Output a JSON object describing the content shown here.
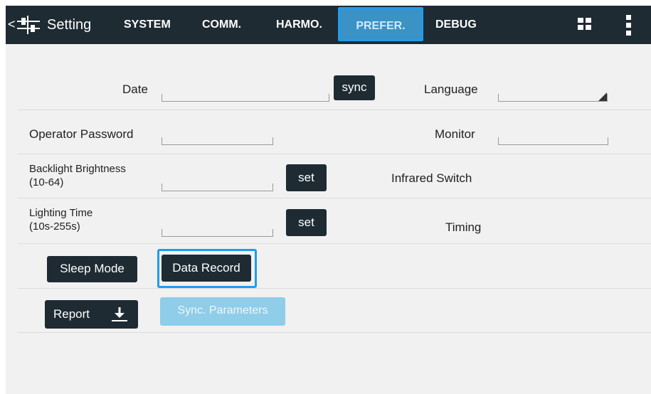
{
  "header": {
    "back_glyph": "<",
    "title": "Setting",
    "tabs": [
      {
        "label": "SYSTEM",
        "active": false
      },
      {
        "label": "COMM.",
        "active": false
      },
      {
        "label": "HARMO.",
        "active": false
      },
      {
        "label": "PREFER.",
        "active": true
      },
      {
        "label": "DEBUG",
        "active": false
      }
    ],
    "icons": [
      "settings-sliders-icon",
      "grid-icon",
      "more-vert-icon"
    ]
  },
  "form": {
    "date": {
      "label": "Date",
      "value": "",
      "sync_label": "sync"
    },
    "language": {
      "label": "Language",
      "value": ""
    },
    "operator_password": {
      "label": "Operator Password",
      "value": ""
    },
    "monitor": {
      "label": "Monitor",
      "value": ""
    },
    "backlight": {
      "label_line1": "Backlight Brightness",
      "label_line2": "(10-64)",
      "value": "",
      "set_label": "set"
    },
    "infrared": {
      "label": "Infrared Switch"
    },
    "lighting": {
      "label_line1": "Lighting Time",
      "label_line2": "(10s-255s)",
      "value": "",
      "set_label": "set"
    },
    "timing": {
      "label": "Timing"
    }
  },
  "actions": {
    "sleep_mode": "Sleep Mode",
    "data_record": "Data Record",
    "report": "Report",
    "sync_parameters": "Sync. Parameters"
  },
  "colors": {
    "topbar": "#1e2b33",
    "accent": "#1f9cf0",
    "light_button": "#8fcde9"
  }
}
